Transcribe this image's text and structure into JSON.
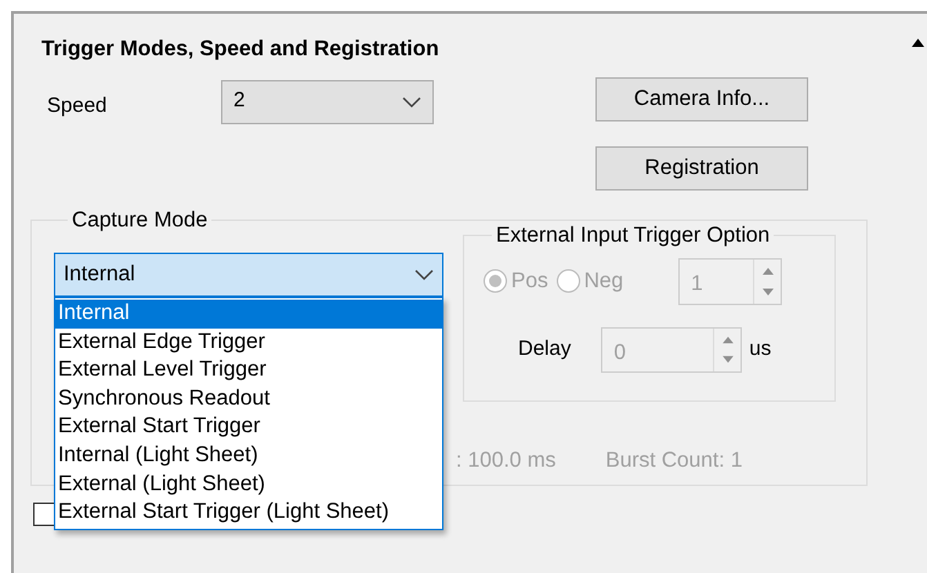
{
  "panel": {
    "title": "Trigger Modes, Speed and Registration",
    "expanded": true
  },
  "speed": {
    "label": "Speed",
    "value": "2"
  },
  "buttons": [
    "Camera Info...",
    "Registration"
  ],
  "capture_mode": {
    "label": "Capture Mode",
    "value": "Internal",
    "expanded": true,
    "options": [
      {
        "label": "Internal",
        "selected": true
      },
      {
        "label": "External Edge Trigger",
        "selected": false
      },
      {
        "label": "External Level Trigger",
        "selected": false
      },
      {
        "label": "Synchronous Readout",
        "selected": false
      },
      {
        "label": "External Start Trigger",
        "selected": false
      },
      {
        "label": "Internal (Light Sheet)",
        "selected": false
      },
      {
        "label": "External (Light Sheet)",
        "selected": false
      },
      {
        "label": "External Start Trigger (Light Sheet)",
        "selected": false
      }
    ]
  },
  "external_trigger": {
    "label": "External Input Trigger Option",
    "disabled": true,
    "polarity": [
      {
        "label": "Pos",
        "selected": true
      },
      {
        "label": "Neg",
        "selected": false
      }
    ],
    "count": "1",
    "delay_label": "Delay",
    "delay": "0",
    "delay_unit": "us"
  },
  "info": [
    ":  100.0 ms",
    "Burst Count:  1"
  ],
  "checkbox": {
    "checked": false
  }
}
